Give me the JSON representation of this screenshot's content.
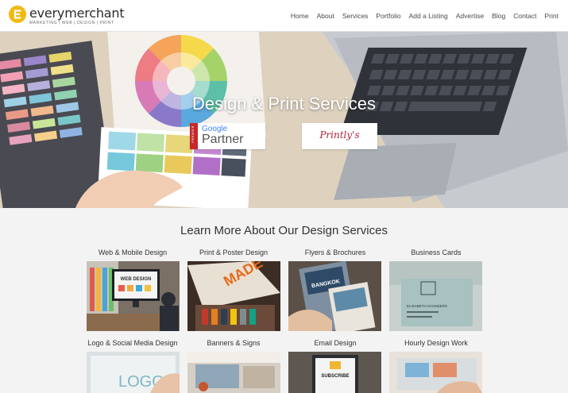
{
  "logo": {
    "name": "everymerchant",
    "tagline": "MARKETING | WEB | DESIGN | PRINT"
  },
  "nav": [
    "Home",
    "About",
    "Services",
    "Portfolio",
    "Add a Listing",
    "Advertise",
    "Blog",
    "Contact",
    "Print"
  ],
  "hero": {
    "title": "Design & Print Services",
    "google_badge": {
      "strip": "PREMIER",
      "brand": "Google",
      "label": "Partner"
    },
    "printlys_badge": {
      "label": "Printly's"
    }
  },
  "services": {
    "title": "Learn More About Our Design Services",
    "items": [
      {
        "label": "Web & Mobile Design",
        "tile_text": "WEB DESIGN"
      },
      {
        "label": "Print & Poster Design"
      },
      {
        "label": "Flyers & Brochures",
        "tile_text": "BANGKOK"
      },
      {
        "label": "Business Cards",
        "tile_text": "ELISABETH SAUNDERS"
      },
      {
        "label": "Logo & Social Media Design",
        "tile_text": "LOGO"
      },
      {
        "label": "Banners & Signs"
      },
      {
        "label": "Email Design",
        "tile_text": "SUBSCRIBE"
      },
      {
        "label": "Hourly Design Work"
      }
    ]
  },
  "colors": {
    "accent": "#f2b90f",
    "google_strip": "#c62828",
    "printlys": "#b0233c"
  }
}
